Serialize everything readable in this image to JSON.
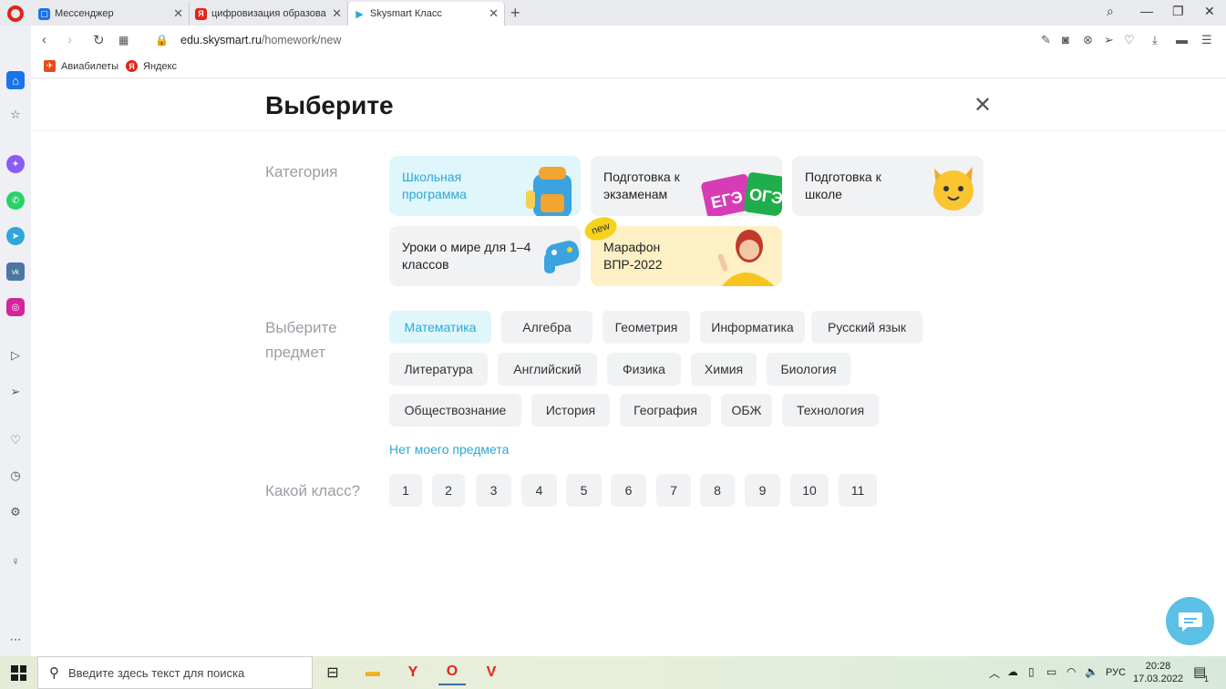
{
  "browser": {
    "tabs": [
      {
        "title": "Мессенджер",
        "icon": "messenger-tab-icon"
      },
      {
        "title": "цифровизация образован",
        "icon": "yandex-tab-icon"
      },
      {
        "title": "Skysmart Класс",
        "icon": "skysmart-tab-icon"
      }
    ],
    "address": {
      "host": "edu.skysmart.ru",
      "path": "/homework/new"
    },
    "bookmarks": [
      {
        "label": "Авиабилеты"
      },
      {
        "label": "Яндекс"
      }
    ]
  },
  "page": {
    "title": "Выберите",
    "category_label": "Категория",
    "categories": [
      {
        "label": "Школьная программа",
        "selected": true
      },
      {
        "label": "Подготовка к экзаменам",
        "art_text_1": "ЕГЭ",
        "art_text_2": "ОГЭ"
      },
      {
        "label": "Подготовка к школе"
      },
      {
        "label": "Уроки о мире для 1–4 классов"
      },
      {
        "label": "Марафон ВПР-2022",
        "badge": "new"
      }
    ],
    "subject_label": "Выберите предмет",
    "subjects": [
      "Математика",
      "Алгебра",
      "Геометрия",
      "Информатика",
      "Русский язык",
      "Литература",
      "Английский",
      "Физика",
      "Химия",
      "Биология",
      "Обществознание",
      "История",
      "География",
      "ОБЖ",
      "Технология"
    ],
    "selected_subject": "Математика",
    "no_subject_link": "Нет моего предмета",
    "grade_label": "Какой класс?",
    "grades": [
      "1",
      "2",
      "3",
      "4",
      "5",
      "6",
      "7",
      "8",
      "9",
      "10",
      "11"
    ]
  },
  "taskbar": {
    "search_placeholder": "Введите здесь текст для поиска",
    "language": "РУС",
    "time": "20:28",
    "date": "17.03.2022",
    "notification_count": "1"
  },
  "colors": {
    "accent": "#2aa9d6",
    "selected_bg": "#dff6fb",
    "chip_bg": "#f1f2f4",
    "marathon_bg": "#fdf0c5",
    "badge_yellow": "#f7d21c"
  }
}
